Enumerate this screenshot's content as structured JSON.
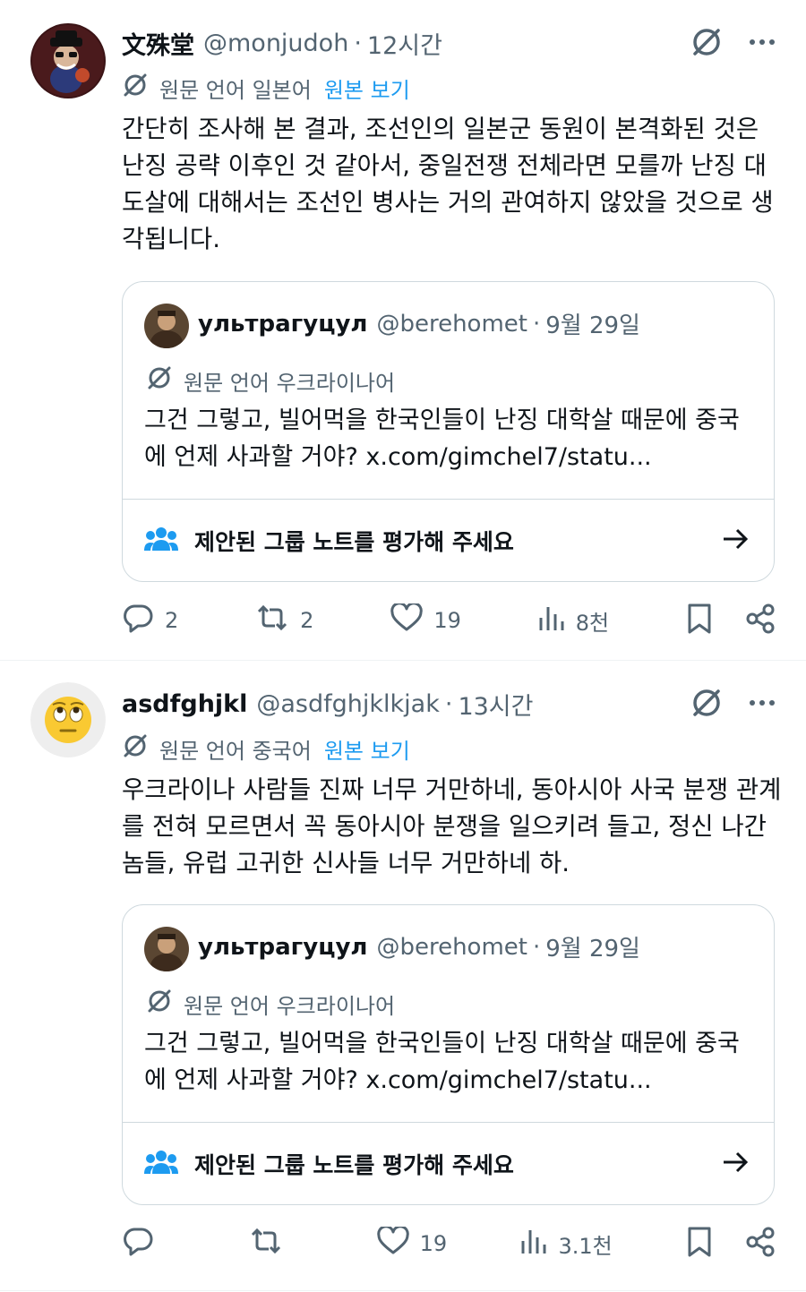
{
  "tweets": [
    {
      "name": "文殊堂",
      "handle": "@monjudoh",
      "separator": "·",
      "time": "12시간",
      "translate_label": "원문 언어 일본어",
      "translate_link": "원본 보기",
      "text": "간단히 조사해 본 결과, 조선인의 일본군 동원이 본격화된 것은 난징 공략 이후인 것 같아서, 중일전쟁 전체라면 모를까 난징 대도살에 대해서는 조선인 병사는 거의 관여하지 않았을 것으로 생각됩니다.",
      "quote": {
        "name": "ультрагуцул",
        "handle": "@berehomet",
        "separator": "·",
        "time": "9월 29일",
        "translate_label": "원문 언어 우크라이나어",
        "text": "그건 그렇고, 빌어먹을 한국인들이 난징 대학살 때문에 중국에 언제 사과할 거야? x.com/gimchel7/statu...",
        "note_label": "제안된 그룹 노트를 평가해 주세요"
      },
      "actions": {
        "replies": "2",
        "reposts": "2",
        "likes": "19",
        "views": "8천"
      }
    },
    {
      "name": "asdfghjkl",
      "handle": "@asdfghjklkjak",
      "separator": "·",
      "time": "13시간",
      "translate_label": "원문 언어 중국어",
      "translate_link": "원본 보기",
      "text": "우크라이나 사람들 진짜 너무 거만하네, 동아시아 사국 분쟁 관계를 전혀 모르면서 꼭 동아시아 분쟁을 일으키려 들고, 정신 나간 놈들, 유럽 고귀한 신사들 너무 거만하네 하.",
      "quote": {
        "name": "ультрагуцул",
        "handle": "@berehomet",
        "separator": "·",
        "time": "9월 29일",
        "translate_label": "원문 언어 우크라이나어",
        "text": "그건 그렇고, 빌어먹을 한국인들이 난징 대학살 때문에 중국에 언제 사과할 거야? x.com/gimchel7/statu...",
        "note_label": "제안된 그룹 노트를 평가해 주세요"
      },
      "actions": {
        "replies": "",
        "reposts": "",
        "likes": "19",
        "views": "3.1천"
      }
    }
  ],
  "icons": {
    "translate": "translate-icon",
    "more": "more-icon",
    "reply": "reply-icon",
    "repost": "repost-icon",
    "like": "like-icon",
    "views": "views-icon",
    "bookmark": "bookmark-icon",
    "share": "share-icon",
    "community_notes": "community-notes-icon",
    "arrow": "arrow-right-icon"
  },
  "colors": {
    "text": "#0f1419",
    "secondary": "#536471",
    "link": "#1d9bf0",
    "border": "#cfd9de"
  }
}
